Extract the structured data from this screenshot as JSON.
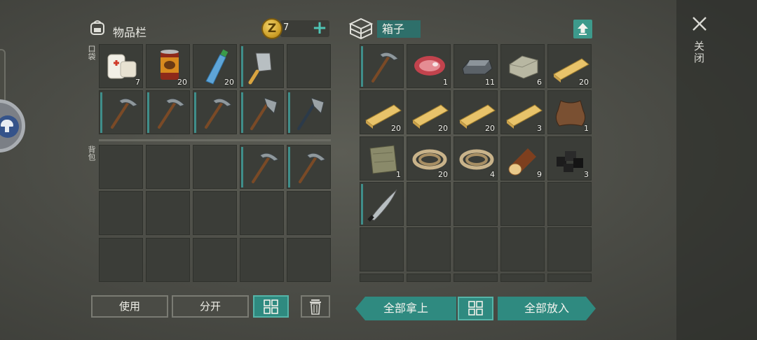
{
  "inventory": {
    "title": "物品栏",
    "coins": "7",
    "pocket_label": "口袋",
    "backpack_label": "背包",
    "pocket_slots": [
      {
        "item": "bandage",
        "qty": "7"
      },
      {
        "item": "canned-food",
        "qty": "20"
      },
      {
        "item": "water-bottle",
        "qty": "20"
      },
      {
        "item": "cleaver",
        "qty": ""
      },
      {
        "item": "empty",
        "qty": ""
      },
      {
        "item": "pickaxe",
        "qty": ""
      },
      {
        "item": "pickaxe",
        "qty": ""
      },
      {
        "item": "pickaxe",
        "qty": ""
      },
      {
        "item": "hatchet",
        "qty": ""
      },
      {
        "item": "hatchet-dark",
        "qty": ""
      }
    ],
    "backpack_slots": [
      {
        "item": "empty",
        "qty": ""
      },
      {
        "item": "empty",
        "qty": ""
      },
      {
        "item": "empty",
        "qty": ""
      },
      {
        "item": "pickaxe",
        "qty": ""
      },
      {
        "item": "pickaxe",
        "qty": ""
      }
    ]
  },
  "box": {
    "title": "箱子",
    "slots": [
      {
        "item": "pickaxe",
        "qty": ""
      },
      {
        "item": "raw-meat",
        "qty": "1"
      },
      {
        "item": "iron-ingot",
        "qty": "11"
      },
      {
        "item": "stone",
        "qty": "6"
      },
      {
        "item": "plank",
        "qty": "20"
      },
      {
        "item": "plank",
        "qty": "20"
      },
      {
        "item": "plank",
        "qty": "20"
      },
      {
        "item": "plank",
        "qty": "20"
      },
      {
        "item": "plank",
        "qty": "3"
      },
      {
        "item": "leather",
        "qty": "1"
      },
      {
        "item": "cloth",
        "qty": "1"
      },
      {
        "item": "rope",
        "qty": "20"
      },
      {
        "item": "rope",
        "qty": "4"
      },
      {
        "item": "log",
        "qty": "9"
      },
      {
        "item": "coal",
        "qty": "3"
      },
      {
        "item": "machete",
        "qty": ""
      }
    ]
  },
  "buttons": {
    "use": "使用",
    "split": "分开",
    "take_all": "全部拿上",
    "put_all": "全部放入"
  },
  "close_label": "关闭",
  "colors": {
    "accent": "#2f8a80",
    "slot": "#3b3d38",
    "background": "#4a4b45"
  }
}
